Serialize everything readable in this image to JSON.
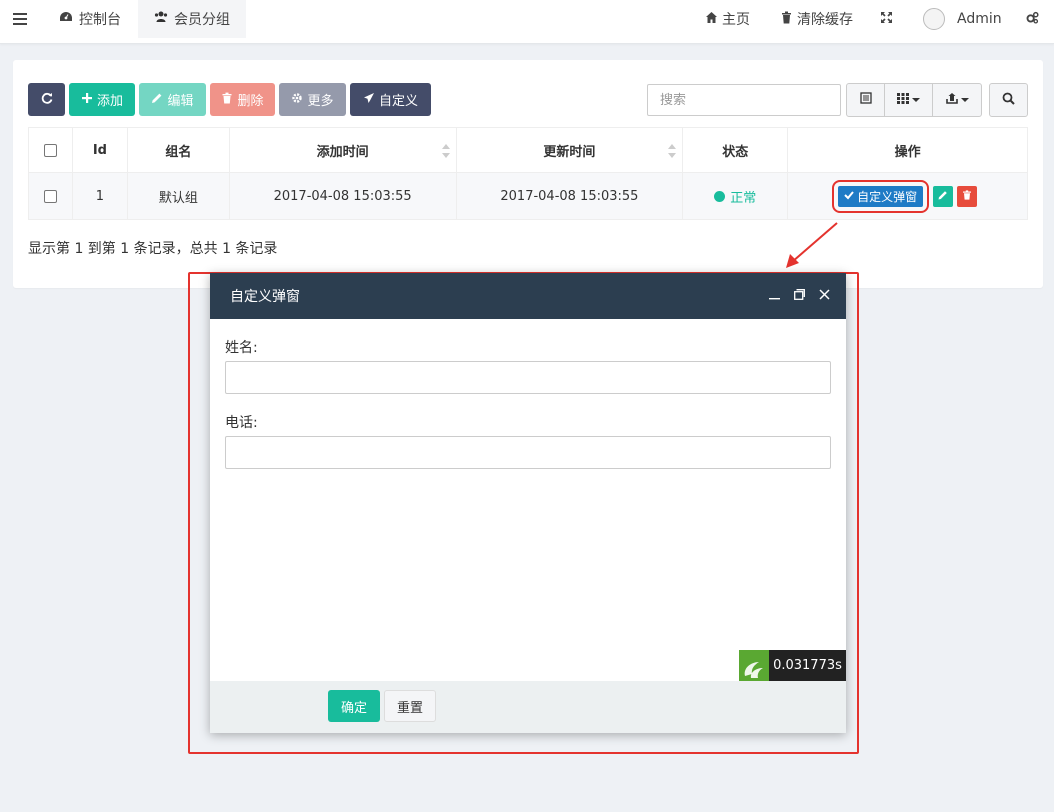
{
  "header": {
    "tabs": [
      {
        "label": "控制台",
        "icon": "dashboard-icon"
      },
      {
        "label": "会员分组",
        "icon": "users-icon"
      }
    ],
    "right": {
      "home_label": "主页",
      "clear_cache_label": "清除缓存",
      "fullscreen_icon": "expand-icon",
      "user_name": "Admin",
      "settings_icon": "gears-icon"
    }
  },
  "toolbar": {
    "refresh_icon": "refresh-icon",
    "add_label": "添加",
    "edit_label": "编辑",
    "delete_label": "删除",
    "more_label": "更多",
    "custom_label": "自定义",
    "search_placeholder": "搜索"
  },
  "table": {
    "columns": [
      "Id",
      "组名",
      "添加时间",
      "更新时间",
      "状态",
      "操作"
    ],
    "rows": [
      {
        "id": "1",
        "name": "默认组",
        "created": "2017-04-08 15:03:55",
        "updated": "2017-04-08 15:03:55",
        "status": "正常",
        "custom_button": "自定义弹窗"
      }
    ]
  },
  "pagination": {
    "info": "显示第 1 到第 1 条记录，总共 1 条记录"
  },
  "dialog": {
    "title": "自定义弹窗",
    "fields": [
      {
        "label": "姓名:",
        "value": ""
      },
      {
        "label": "电话:",
        "value": ""
      }
    ],
    "ok_label": "确定",
    "reset_label": "重置",
    "trace_time": "0.031773s"
  },
  "colors": {
    "primary": "#18bc9c",
    "danger": "#e74c3c",
    "dark": "#444c69",
    "dialog_header": "#2c3e50",
    "highlight": "#e4332e"
  }
}
